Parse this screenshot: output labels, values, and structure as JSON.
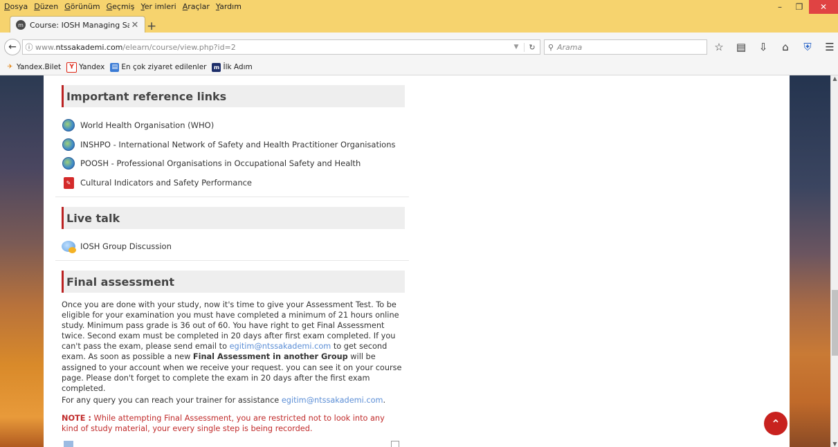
{
  "menubar": {
    "items": [
      "Dosya",
      "Düzen",
      "Görünüm",
      "Geçmiş",
      "Yer imleri",
      "Araçlar",
      "Yardım"
    ]
  },
  "tab": {
    "title": "Course: IOSH Managing Saf",
    "favicon": "moodle-icon"
  },
  "navbar": {
    "url_prefix": "www.",
    "url_domain": "ntssakademi.com",
    "url_path": "/elearn/course/view.php?id=2",
    "search_placeholder": "Arama"
  },
  "bookmarks": [
    {
      "label": "Yandex.Bilet",
      "icon": "plane-icon"
    },
    {
      "label": "Yandex",
      "icon": "yandex-icon"
    },
    {
      "label": "En çok ziyaret edilenler",
      "icon": "bookmark-folder-icon"
    },
    {
      "label": "İlk Adım",
      "icon": "ilk-adim-icon"
    }
  ],
  "sections": {
    "links": {
      "title": "Important reference links",
      "items": [
        {
          "label": "World Health Organisation (WHO)",
          "icon": "globe-icon"
        },
        {
          "label": "INSHPO - International Network of Safety and Health Practitioner Organisations",
          "icon": "globe-icon"
        },
        {
          "label": "POOSH - Professional Organisations in Occupational Safety and Health",
          "icon": "globe-icon"
        },
        {
          "label": "Cultural Indicators and Safety Performance",
          "icon": "pdf-icon"
        }
      ]
    },
    "live": {
      "title": "Live talk",
      "items": [
        {
          "label": "IOSH Group Discussion",
          "icon": "chat-icon"
        }
      ]
    },
    "final": {
      "title": "Final assessment",
      "p1_a": "Once you are done with your study, now it's time to give your Assessment Test. To be eligible for your examination you must have completed a minimum of 21 hours online study. Minimum pass grade is 36 out of 60. You have right to get Final Assessment twice. Second exam must be completed in 20 days after first exam completed.  If you can't pass the exam, please send email to ",
      "p1_link": "egitim@ntssakademi.com",
      "p1_b": " to get second exam. As soon as possible a new ",
      "p1_bold": "Final Assessment in another Group",
      "p1_c": " will be assigned to your account when we receive your request. you can see it on your course page. Please don't forget to complete the exam in 20 days after the first exam completed.",
      "p2_text": "For any query you can reach your trainer for assistance  ",
      "p2_link": "egitim@ntssakademi.com",
      "p2_end": ".",
      "note_label": "NOTE :",
      "note_text": " While attempting Final Assessment, you are restricted not to look into any kind of study material, your every single step is being recorded."
    }
  },
  "colors": {
    "menubar_bg": "#f6d36e",
    "section_accent": "#bb2222",
    "link": "#5b8ed6",
    "note": "#c02a2a",
    "fab": "#c8221f"
  }
}
